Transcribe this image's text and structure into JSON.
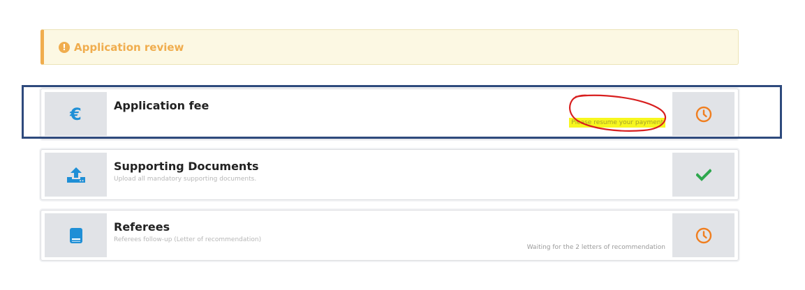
{
  "alert": {
    "title": "Application review",
    "icon": "exclamation-circle-icon",
    "color": "#f0ad4e"
  },
  "cards": [
    {
      "title": "Application fee",
      "subtitle": "",
      "left_icon": "euro-icon",
      "right_icon": "clock-icon",
      "note": "Please resume your payment",
      "note_highlight": "#f7f71e",
      "status": "pending"
    },
    {
      "title": "Supporting Documents",
      "subtitle": "Upload all mandatory supporting documents.",
      "left_icon": "upload-icon",
      "right_icon": "check-icon",
      "note": "",
      "status": "complete"
    },
    {
      "title": "Referees",
      "subtitle": "Referees follow-up (Letter of recommendation)",
      "left_icon": "book-icon",
      "right_icon": "clock-icon",
      "note": "Waiting for the 2 letters of recommendation",
      "status": "pending"
    }
  ],
  "colors": {
    "accent_blue": "#1f8fd6",
    "pending_orange": "#f07e1f",
    "success_green": "#2ea84e",
    "frame_navy": "#2e4a7d",
    "annotation_red": "#d81f1f"
  }
}
